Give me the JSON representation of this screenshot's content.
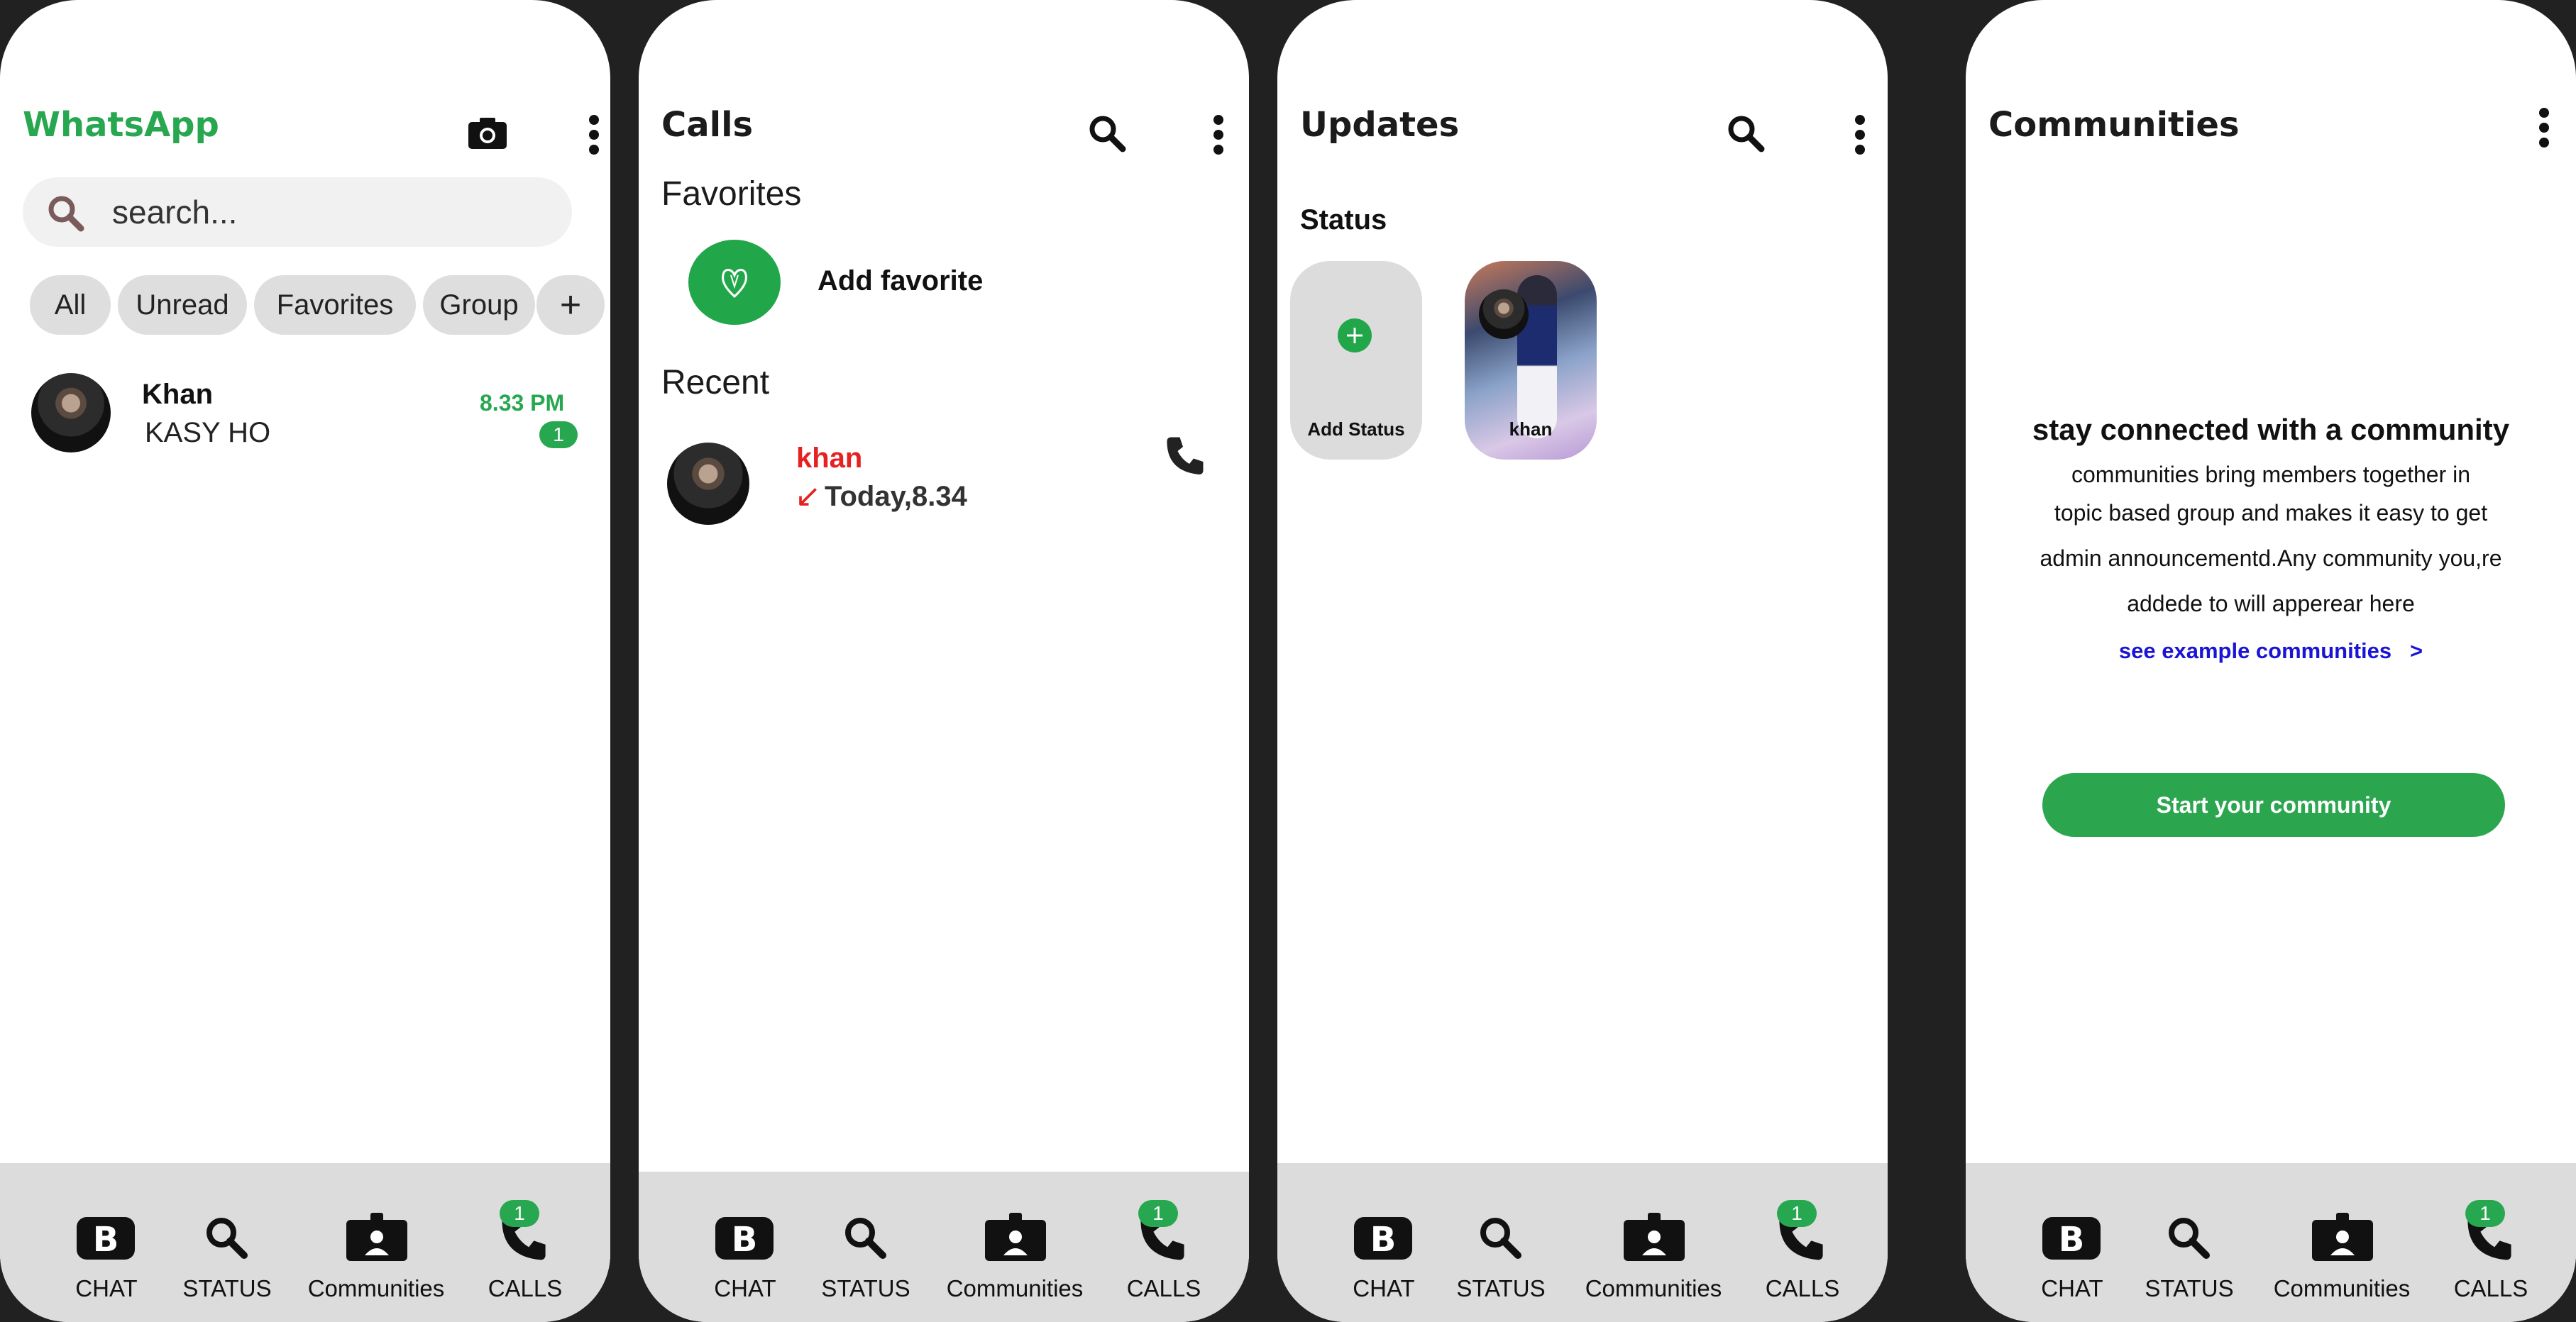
{
  "screens": {
    "chats": {
      "title": "WhatsApp",
      "search_placeholder": "search...",
      "filters": [
        "All",
        "Unread",
        "Favorites",
        "Group"
      ],
      "add_filter_symbol": "+",
      "chat": {
        "name": "Khan",
        "message": "KASY HO",
        "time": "8.33  PM",
        "unread": "1"
      }
    },
    "calls": {
      "title": "Calls",
      "favorites_heading": "Favorites",
      "add_favorite": "Add favorite",
      "recent_heading": "Recent",
      "recent_call": {
        "name": "khan",
        "arrow": "↙",
        "when": "Today,8.34"
      }
    },
    "updates": {
      "title": "Updates",
      "status_heading": "Status",
      "add_status": "Add Status",
      "status_name": "khan"
    },
    "communities": {
      "title": "Communities",
      "headline": "stay connected with a community",
      "body_lines": [
        "communities bring members together in",
        "topic based group and makes it easy to get",
        "admin announcementd.Any community you,re",
        "addede to will apperear here"
      ],
      "link": "see example communities   >",
      "button": "Start your community"
    }
  },
  "bottom_nav": {
    "items": [
      {
        "label": "CHAT",
        "icon": "bold-b-icon"
      },
      {
        "label": "STATUS",
        "icon": "search-icon"
      },
      {
        "label": "Communities",
        "icon": "id-card-icon"
      },
      {
        "label": "CALLS",
        "icon": "phone-icon"
      }
    ],
    "calls_badge": "1"
  },
  "colors": {
    "accent_green": "#27a74f",
    "missed_red": "#e52222",
    "link_blue": "#1a14d6",
    "frame_background": "#212121",
    "nav_background": "#dcdcdc"
  }
}
